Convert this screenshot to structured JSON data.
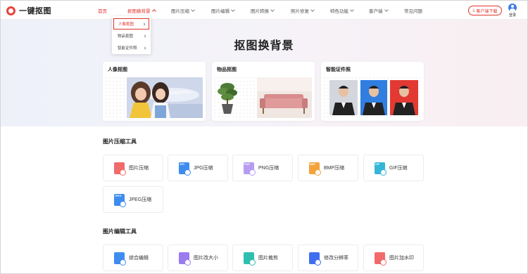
{
  "header": {
    "logo_text": "一键抠图",
    "nav": [
      {
        "label": "首页",
        "has_chevron": false
      },
      {
        "label": "抠图换背景",
        "has_chevron": true
      },
      {
        "label": "图片压缩",
        "has_chevron": true
      },
      {
        "label": "图片编辑",
        "has_chevron": true
      },
      {
        "label": "图片转换",
        "has_chevron": true
      },
      {
        "label": "照片修复",
        "has_chevron": true
      },
      {
        "label": "特色功能",
        "has_chevron": true
      },
      {
        "label": "客户端",
        "has_chevron": true
      },
      {
        "label": "常见问题",
        "has_chevron": false
      }
    ],
    "download_label": "客户端下载",
    "login_label": "登录"
  },
  "dropdown": {
    "items": [
      "人像抠图",
      "物品抠图",
      "智能证件照"
    ]
  },
  "hero": {
    "title": "抠图换背景",
    "cards": [
      {
        "title": "人像抠图"
      },
      {
        "title": "物品抠图"
      },
      {
        "title": "智能证件照"
      }
    ]
  },
  "compress": {
    "title": "图片压缩工具",
    "tools": [
      {
        "label": "图片压缩",
        "icon": "image-compress-icon",
        "tag": "",
        "color": "#f26b6b"
      },
      {
        "label": "JPG压缩",
        "icon": "jpg-file-icon",
        "tag": "JPG",
        "color": "#3f8cf0"
      },
      {
        "label": "PNG压缩",
        "icon": "png-file-icon",
        "tag": "PNG",
        "color": "#b79cf2"
      },
      {
        "label": "BMP压缩",
        "icon": "bmp-file-icon",
        "tag": "BMP",
        "color": "#f4a23a"
      },
      {
        "label": "GIF压缩",
        "icon": "gif-file-icon",
        "tag": "GIF",
        "color": "#35b6d6"
      },
      {
        "label": "JPEG压缩",
        "icon": "jpeg-file-icon",
        "tag": "JPEG",
        "color": "#3f8cf0"
      }
    ]
  },
  "edit": {
    "title": "图片编辑工具",
    "tools": [
      {
        "label": "综合编辑",
        "icon": "edit-icon",
        "tag": "",
        "color": "#3f8cf0"
      },
      {
        "label": "图片改大小",
        "icon": "resize-icon",
        "tag": "",
        "color": "#9b7cf0"
      },
      {
        "label": "图片裁剪",
        "icon": "crop-icon",
        "tag": "",
        "color": "#2fbfb0"
      },
      {
        "label": "修改分辨率",
        "icon": "resolution-icon",
        "tag": "",
        "color": "#3f6ff0"
      },
      {
        "label": "图片加水印",
        "icon": "watermark-icon",
        "tag": "",
        "color": "#f26b6b"
      }
    ]
  },
  "colors": {
    "accent": "#e0322d"
  }
}
